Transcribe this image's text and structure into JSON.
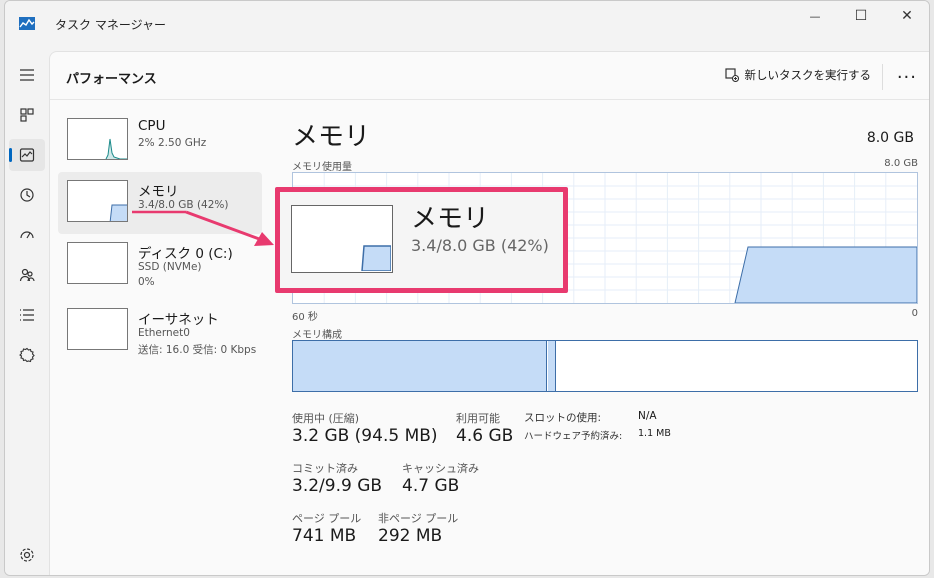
{
  "window": {
    "title": "タスク マネージャー"
  },
  "title_controls": {
    "minimize": "—",
    "maximize": "☐",
    "close": "✕"
  },
  "page": {
    "title": "パフォーマンス",
    "run_task": "新しいタスクを実行する",
    "more": "..."
  },
  "sidebar": [
    {
      "name": "CPU",
      "sub1": "2%  2.50 GHz"
    },
    {
      "name": "メモリ",
      "sub1": "3.4/8.0 GB (42%)"
    },
    {
      "name": "ディスク 0 (C:)",
      "sub1": "SSD (NVMe)",
      "sub2": "0%"
    },
    {
      "name": "イーサネット",
      "sub1": "Ethernet0",
      "sub2": "送信: 16.0  受信: 0 Kbps"
    }
  ],
  "main": {
    "title": "メモリ",
    "total": "8.0 GB",
    "usage_label": "メモリ使用量",
    "usage_max": "8.0 GB",
    "time_left": "60 秒",
    "time_right": "0",
    "composition_label": "メモリ構成",
    "memory_usage_percent": 42
  },
  "stats": {
    "in_use_label": "使用中 (圧縮)",
    "in_use_value": "3.2 GB (94.5 MB)",
    "available_label": "利用可能",
    "available_value": "4.6 GB",
    "committed_label": "コミット済み",
    "committed_value": "3.2/9.9 GB",
    "cached_label": "キャッシュ済み",
    "cached_value": "4.7 GB",
    "paged_label": "ページ プール",
    "paged_value": "741 MB",
    "nonpaged_label": "非ページ プール",
    "nonpaged_value": "292 MB",
    "slots_label": "スロットの使用:",
    "slots_value": "N/A",
    "hw_reserved_label": "ハードウェア予約済み:",
    "hw_reserved_value": "1.1 MB"
  },
  "callout": {
    "name": "メモリ",
    "sub": "3.4/8.0 GB (42%)"
  },
  "colors": {
    "accent": "#0067c0",
    "memory_fill": "#c5dcf7",
    "memory_line": "#3d6ea8",
    "callout": "#e83a6f",
    "cpu": "#1a8a8a"
  },
  "icons": [
    "hamburger-icon",
    "processes-icon",
    "performance-icon",
    "history-icon",
    "startup-icon",
    "users-icon",
    "details-icon",
    "services-icon",
    "settings-icon",
    "run-task-icon"
  ]
}
